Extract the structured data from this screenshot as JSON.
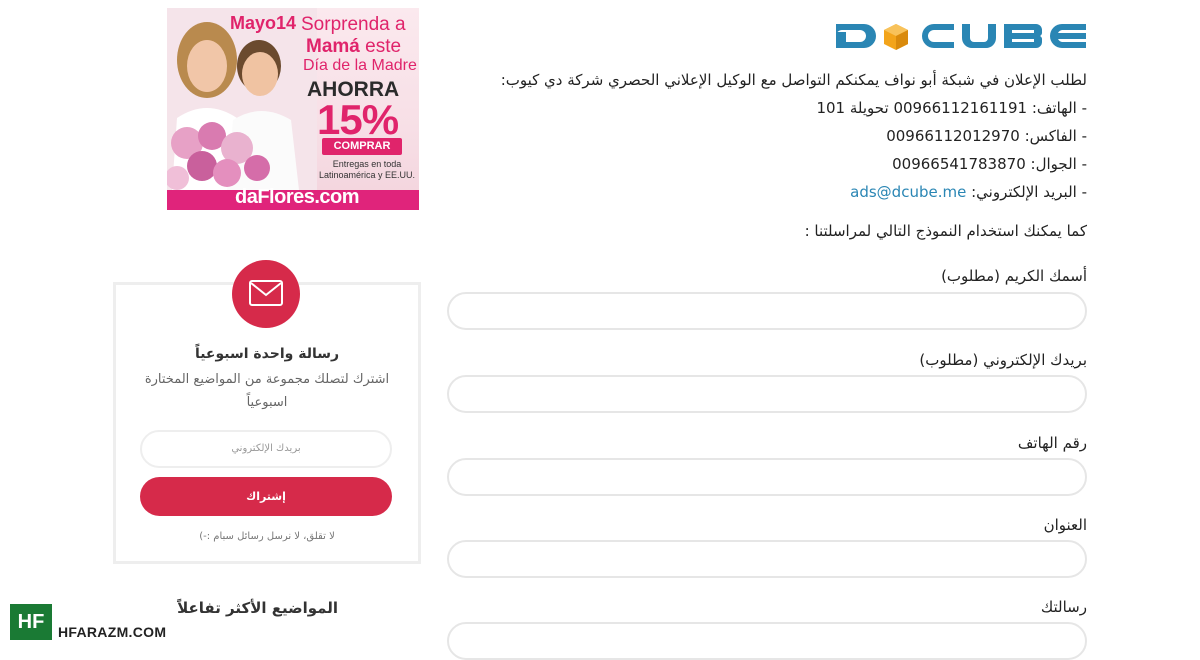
{
  "logo": {
    "text": "DCUBE",
    "icon": "cube-logo-icon",
    "colors": {
      "primary": "#2a86b4",
      "accent": "#f3a41a"
    }
  },
  "contact": {
    "intro": "لطلب الإعلان في شبكة أبو نواف يمكنكم التواصل مع الوكيل الإعلاني الحصري شركة دي كيوب:",
    "phone_label": "- الهاتف:",
    "phone_value": "00966112161191 تحويلة 101",
    "fax_label": "- الفاكس:",
    "fax_value": "00966112012970",
    "mobile_label": "- الجوال:",
    "mobile_value": "00966541783870",
    "email_label": "- البريد الإلكتروني:",
    "email_value": "ads@dcube.me"
  },
  "form": {
    "intro": "كما يمكنك استخدام النموذج التالي لمراسلتنا :",
    "name_label": "أسمك الكريم (مطلوب)",
    "name_value": "",
    "email_label": "بريدك الإلكتروني (مطلوب)",
    "email_value": "",
    "phone_label": "رقم الهاتف",
    "phone_value": "",
    "address_label": "العنوان",
    "address_value": "",
    "message_label": "رسالتك",
    "message_value": ""
  },
  "ad": {
    "date_text": "Mayo",
    "date_num": "14",
    "line1": "Sorprenda a",
    "line2_bold": "Mamá",
    "line2_rest": " este",
    "line3": "Día de la Madre",
    "ahorra": "AHORRA",
    "percent": "15%",
    "button": "COMPRAR",
    "small": "Entregas en toda Latinoamérica y EE.UU.",
    "brand": "daFlores.com",
    "colors": {
      "pink": "#e0246b",
      "bar": "#e0247b"
    }
  },
  "newsletter": {
    "icon": "envelope-icon",
    "title": "رسالة واحدة اسبوعياً",
    "desc": "اشترك لتصلك مجموعة من المواضيع المختارة اسبوعياً",
    "placeholder": "بريدك الإلكتروني",
    "button": "إشتراك",
    "note": "لا تقلق، لا نرسل رسائل سبام :-)",
    "accent": "#d62a4a"
  },
  "sidebar": {
    "popular_title": "المواضيع الأكثر تفاعلاً"
  },
  "watermark": {
    "badge": "HF",
    "site": "HFARAZM.COM",
    "color": "#1a7a34"
  }
}
